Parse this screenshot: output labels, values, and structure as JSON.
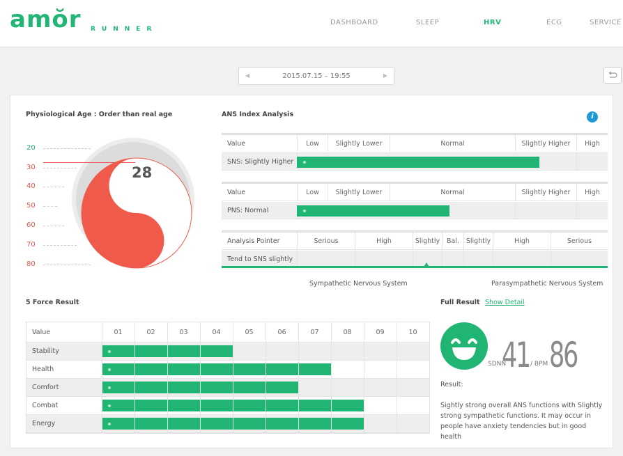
{
  "header": {
    "logo": "amŏr",
    "logo_sub": "RUNNER",
    "nav": [
      "DASHBOARD",
      "SLEEP",
      "HRV",
      "ECG",
      "SERVICE"
    ],
    "active_nav": "HRV"
  },
  "date_picker": {
    "value": "2015.07.15 – 19:55",
    "prev": "◀",
    "next": "▶"
  },
  "physio": {
    "title": "Physiological Age : Order than real age",
    "ages": [
      "20",
      "30",
      "40",
      "50",
      "60",
      "70",
      "80"
    ],
    "value": "28"
  },
  "ans": {
    "title": "ANS Index Analysis",
    "info_icon": "i",
    "sns": {
      "header": [
        "Value",
        "Low",
        "Slightly Lower",
        "Normal",
        "Slightly Higher",
        "High"
      ],
      "label": "SNS: Slightly Higher",
      "level": 0.78
    },
    "pns": {
      "header": [
        "Value",
        "Low",
        "Slightly Lower",
        "Normal",
        "Slightly Higher",
        "High"
      ],
      "label": "PNS: Normal",
      "level": 0.49
    },
    "pointer": {
      "header": [
        "Analysis Pointer",
        "Serious",
        "High",
        "Slightly",
        "Bal.",
        "Slightly",
        "High",
        "Serious"
      ],
      "label": "Tend to SNS slightly",
      "left_axis": "Sympathetic Nervous System",
      "right_axis": "Parasympathetic Nervous System"
    }
  },
  "force": {
    "title": "5 Force Result",
    "columns": [
      "Value",
      "01",
      "02",
      "03",
      "04",
      "05",
      "06",
      "07",
      "08",
      "09",
      "10"
    ],
    "rows": [
      {
        "label": "Stability",
        "value": 4
      },
      {
        "label": "Health",
        "value": 7
      },
      {
        "label": "Comfort",
        "value": 6
      },
      {
        "label": "Combat",
        "value": 8
      },
      {
        "label": "Energy",
        "value": 8
      }
    ]
  },
  "full_result": {
    "title": "Full Result",
    "link": "Show Detail",
    "sdnn_label": "SDNN",
    "sdnn": "41",
    "bpm_label": "/ BPM",
    "bpm": "86",
    "result_label": "Result:",
    "result_text": "Sightly strong overall ANS functions with Slightly strong sympathetic functions. It may occur in people have anxiety tendencies but in good health"
  },
  "colors": {
    "accent": "#22b573",
    "age_red": "#f05a4b"
  }
}
